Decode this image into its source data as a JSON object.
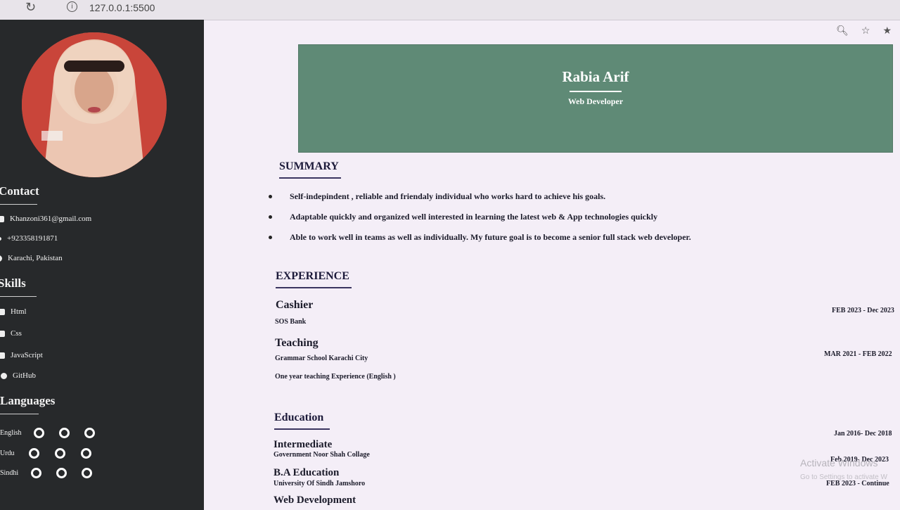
{
  "browser": {
    "url": "127.0.0.1:5500"
  },
  "sidebar": {
    "contact_heading": "Contact",
    "contact": [
      {
        "icon": "mail-icon",
        "text": "Khanzoni361@gmail.com"
      },
      {
        "icon": "phone-icon",
        "text": "+923358191871"
      },
      {
        "icon": "location-icon",
        "text": "Karachi, Pakistan"
      }
    ],
    "skills_heading": "Skills",
    "skills": [
      {
        "icon": "html-icon",
        "text": "Html"
      },
      {
        "icon": "css-icon",
        "text": "Css"
      },
      {
        "icon": "javascript-icon",
        "text": "JavaScript"
      },
      {
        "icon": "github-icon",
        "text": "GitHub"
      }
    ],
    "languages_heading": "Languages",
    "languages": [
      {
        "name": "English"
      },
      {
        "name": "Urdu"
      },
      {
        "name": "Sindhi"
      }
    ]
  },
  "header": {
    "name": "Rabia Arif",
    "role": "Web Developer",
    "background_color": "#5f8a76"
  },
  "summary": {
    "heading": "SUMMARY",
    "items": [
      "Self-indepindent , reliable and friendaly individual who works hard to achieve his goals.",
      "Adaptable quickly and organized well interested in learning the latest web & App technologies quickly",
      "Able to work well in teams as well as individually. My future goal is to become a senior full stack web developer."
    ]
  },
  "experience": {
    "heading": "EXPERIENCE",
    "jobs": [
      {
        "title": "Cashier",
        "org": "SOS Bank",
        "date": "FEB 2023 - Dec 2023"
      },
      {
        "title": "Teaching",
        "org": "Grammar School Karachi City",
        "note": "One year teaching Experience (English )",
        "date": "MAR 2021 - FEB 2022"
      }
    ]
  },
  "education": {
    "heading": "Education",
    "items": [
      {
        "title": "Intermediate",
        "org": "Government Noor Shah Collage",
        "date": "Jan 2016- Dec 2018"
      },
      {
        "title": "B.A Education",
        "org": "University Of Sindh Jamshoro",
        "date": "Feb 2019- Dec 2023"
      },
      {
        "title": "Web Development",
        "date": "FEB 2023 - Continue"
      }
    ]
  },
  "os_watermark": {
    "title": "Activate Windows",
    "subtitle": "Go to Settings to activate W"
  }
}
